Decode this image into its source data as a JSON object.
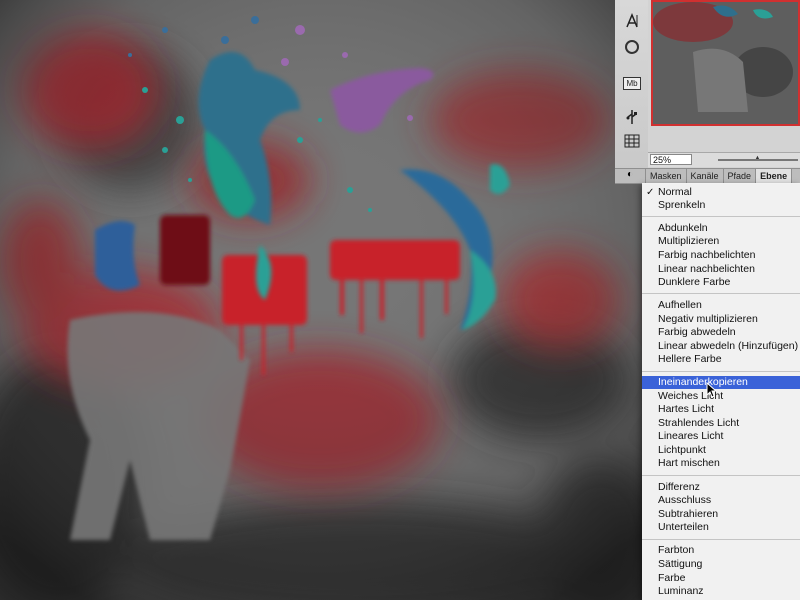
{
  "navigator": {
    "zoom": "25%"
  },
  "tabs": [
    {
      "label": "Masken",
      "active": false
    },
    {
      "label": "Kanäle",
      "active": false
    },
    {
      "label": "Pfade",
      "active": false
    },
    {
      "label": "Ebene",
      "active": true
    }
  ],
  "toolbar": {
    "icons": [
      "text-tool-icon",
      "circle-tool-icon",
      "mb-icon",
      "usb-icon",
      "grid-icon"
    ],
    "mb_label": "Mb"
  },
  "blend_menu": {
    "groups": [
      [
        "Normal",
        "Sprenkeln"
      ],
      [
        "Abdunkeln",
        "Multiplizieren",
        "Farbig nachbelichten",
        "Linear nachbelichten",
        "Dunklere Farbe"
      ],
      [
        "Aufhellen",
        "Negativ multiplizieren",
        "Farbig abwedeln",
        "Linear abwedeln (Hinzufügen)",
        "Hellere Farbe"
      ],
      [
        "Ineinanderkopieren",
        "Weiches Licht",
        "Hartes Licht",
        "Strahlendes Licht",
        "Lineares Licht",
        "Lichtpunkt",
        "Hart mischen"
      ],
      [
        "Differenz",
        "Ausschluss",
        "Subtrahieren",
        "Unterteilen"
      ],
      [
        "Farbton",
        "Sättigung",
        "Farbe",
        "Luminanz"
      ]
    ],
    "checked": "Normal",
    "selected": "Ineinanderkopieren"
  },
  "colors": {
    "selection": "#3a62d8",
    "paint_red": "#c8202a",
    "paint_teal": "#1f8f8a",
    "paint_blue": "#2f5f9a",
    "paint_purple": "#8a5a9e"
  }
}
